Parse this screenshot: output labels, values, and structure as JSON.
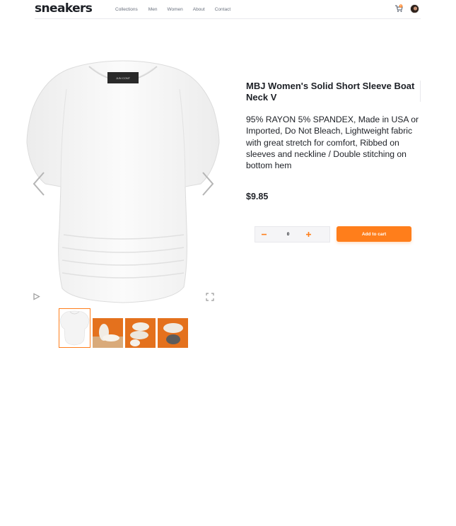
{
  "header": {
    "logo": "sneakers",
    "nav": [
      "Collections",
      "Men",
      "Women",
      "About",
      "Contact"
    ],
    "cart_count": "0"
  },
  "product": {
    "title": "MBJ Women's Solid Short Sleeve Boat Neck V",
    "description": "95% RAYON 5% SPANDEX, Made in USA or Imported, Do Not Bleach, Lightweight fabric with great stretch for comfort, Ribbed on sleeves and neckline / Double stitching on bottom hem",
    "price": "$9.85",
    "quantity": "0",
    "add_to_cart_label": "Add to cart",
    "tag_text": "JUN CONT"
  },
  "colors": {
    "accent": "#ff7e1b",
    "text": "#1d2026",
    "muted": "#69707d"
  },
  "icons": [
    "cart-icon",
    "avatar",
    "chevron-left-icon",
    "chevron-right-icon",
    "play-icon",
    "fullscreen-icon",
    "minus-icon",
    "plus-icon"
  ]
}
